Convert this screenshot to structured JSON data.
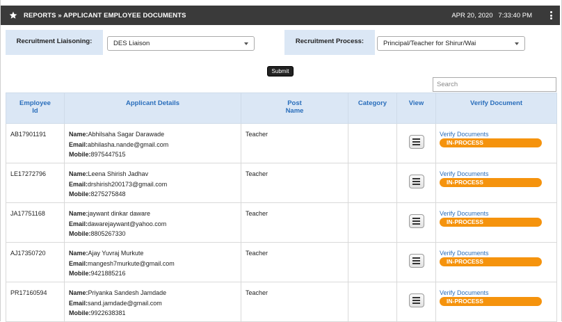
{
  "header": {
    "title": "REPORTS » APPLICANT EMPLOYEE DOCUMENTS",
    "datetime": "APR 20, 2020   7:33:40 PM",
    "icons": [
      "star-icon",
      "kebab-menu-icon"
    ]
  },
  "filters": {
    "liaisoning_label": "Recruitment Liaisoning:",
    "liaisoning_value": "DES Liaison",
    "process_label": "Recruitment Process:",
    "process_value": "Principal/Teacher for Shirur/Wai"
  },
  "submit_label": "Submit",
  "search": {
    "placeholder": "Search"
  },
  "table": {
    "headers": {
      "emp_id_1": "Employee",
      "emp_id_2": "Id",
      "details": "Applicant Details",
      "post_1": "Post",
      "post_2": "Name",
      "category": "Category",
      "view": "View",
      "verify": "Verify Document"
    },
    "field_labels": {
      "name": "Name:",
      "email": "Email:",
      "mobile": "Mobile:"
    },
    "rows": [
      {
        "id": "AB17901191",
        "name": "Abhilsaha Sagar Darawade",
        "email": "abhilasha.nande@gmail.com",
        "mobile": "8975447515",
        "post": "Teacher",
        "category": "",
        "verify_link": "Verify Documents",
        "status": "IN-PROCESS"
      },
      {
        "id": "LE17272796",
        "name": "Leena Shirish Jadhav",
        "email": "drshirish200173@gmail.com",
        "mobile": "8275275848",
        "post": "Teacher",
        "category": "",
        "verify_link": "Verify Documents",
        "status": "IN-PROCESS"
      },
      {
        "id": "JA17751168",
        "name": "jaywant dinkar daware",
        "email": "dawarejaywant@yahoo.com",
        "mobile": "8805267330",
        "post": "Teacher",
        "category": "",
        "verify_link": "Verify Documents",
        "status": "IN-PROCESS"
      },
      {
        "id": "AJ17350720",
        "name": "Ajay Yuvraj Murkute",
        "email": "mangesh7murkute@gmail.com",
        "mobile": "9421885216",
        "post": "Teacher",
        "category": "",
        "verify_link": "Verify Documents",
        "status": "IN-PROCESS"
      },
      {
        "id": "PR17160594",
        "name": "Priyanka Sandesh Jamdade",
        "email": "sand.jamdade@gmail.com",
        "mobile": "9922638381",
        "post": "Teacher",
        "category": "",
        "verify_link": "Verify Documents",
        "status": "IN-PROCESS"
      }
    ]
  },
  "colors": {
    "header_bg": "#3a3a3a",
    "label_bg": "#dbe7f5",
    "link": "#2a6ebb",
    "badge": "#f5930d"
  }
}
